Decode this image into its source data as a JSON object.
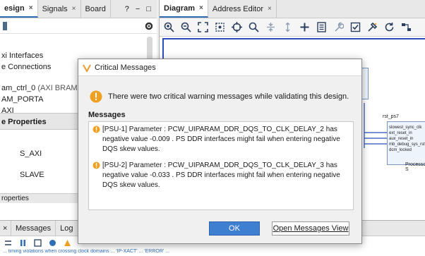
{
  "left_panel": {
    "tabs": [
      {
        "label": "esign",
        "close": "×"
      },
      {
        "label": "Signals",
        "close": "×"
      },
      {
        "label": "Board",
        "close": ""
      }
    ],
    "tab_controls": [
      "?",
      "−",
      "□"
    ],
    "tree": [
      "xi Interfaces",
      "e Connections",
      "am_ctrl_0",
      "AM_PORTA",
      "AXI"
    ],
    "tree_note": "(AXI BRAM Contro",
    "properties_header": "e Properties",
    "props": [
      "S_AXI",
      "SLAVE"
    ],
    "properties_footer": "roperties"
  },
  "diagram": {
    "tabs": [
      {
        "label": "Diagram",
        "close": "×"
      },
      {
        "label": "Address Editor",
        "close": "×"
      }
    ],
    "block_title": "rst_ps7",
    "block_sub": "Processor S",
    "ports": [
      "slowest_sync_clk",
      "ext_reset_in",
      "aux_reset_in",
      "mb_debug_sys_rst",
      "dcm_locked"
    ]
  },
  "bottom_panel": {
    "tabs": [
      {
        "label": "Messages"
      },
      {
        "label": "Log"
      }
    ],
    "status_text": "... timing violations when crossing clock domains ... 'IP-XACT' ... 'ERROR' ... "
  },
  "dialog": {
    "title": "Critical Messages",
    "summary": "There were two critical warning messages while validating this design.",
    "section": "Messages",
    "messages": [
      "[PSU-1]  Parameter : PCW_UIPARAM_DDR_DQS_TO_CLK_DELAY_2 has negative value -0.009 . PS DDR interfaces might fail when entering negative DQS skew values.",
      "[PSU-2]  Parameter : PCW_UIPARAM_DDR_DQS_TO_CLK_DELAY_3 has negative value -0.033 . PS DDR interfaces might fail when entering negative DQS skew values."
    ],
    "ok_label": "OK",
    "open_view_label": "Open Messages View"
  },
  "colors": {
    "accent": "#3e7fd1",
    "warning": "#f0a020",
    "canvas_border": "#2a4dbb"
  }
}
